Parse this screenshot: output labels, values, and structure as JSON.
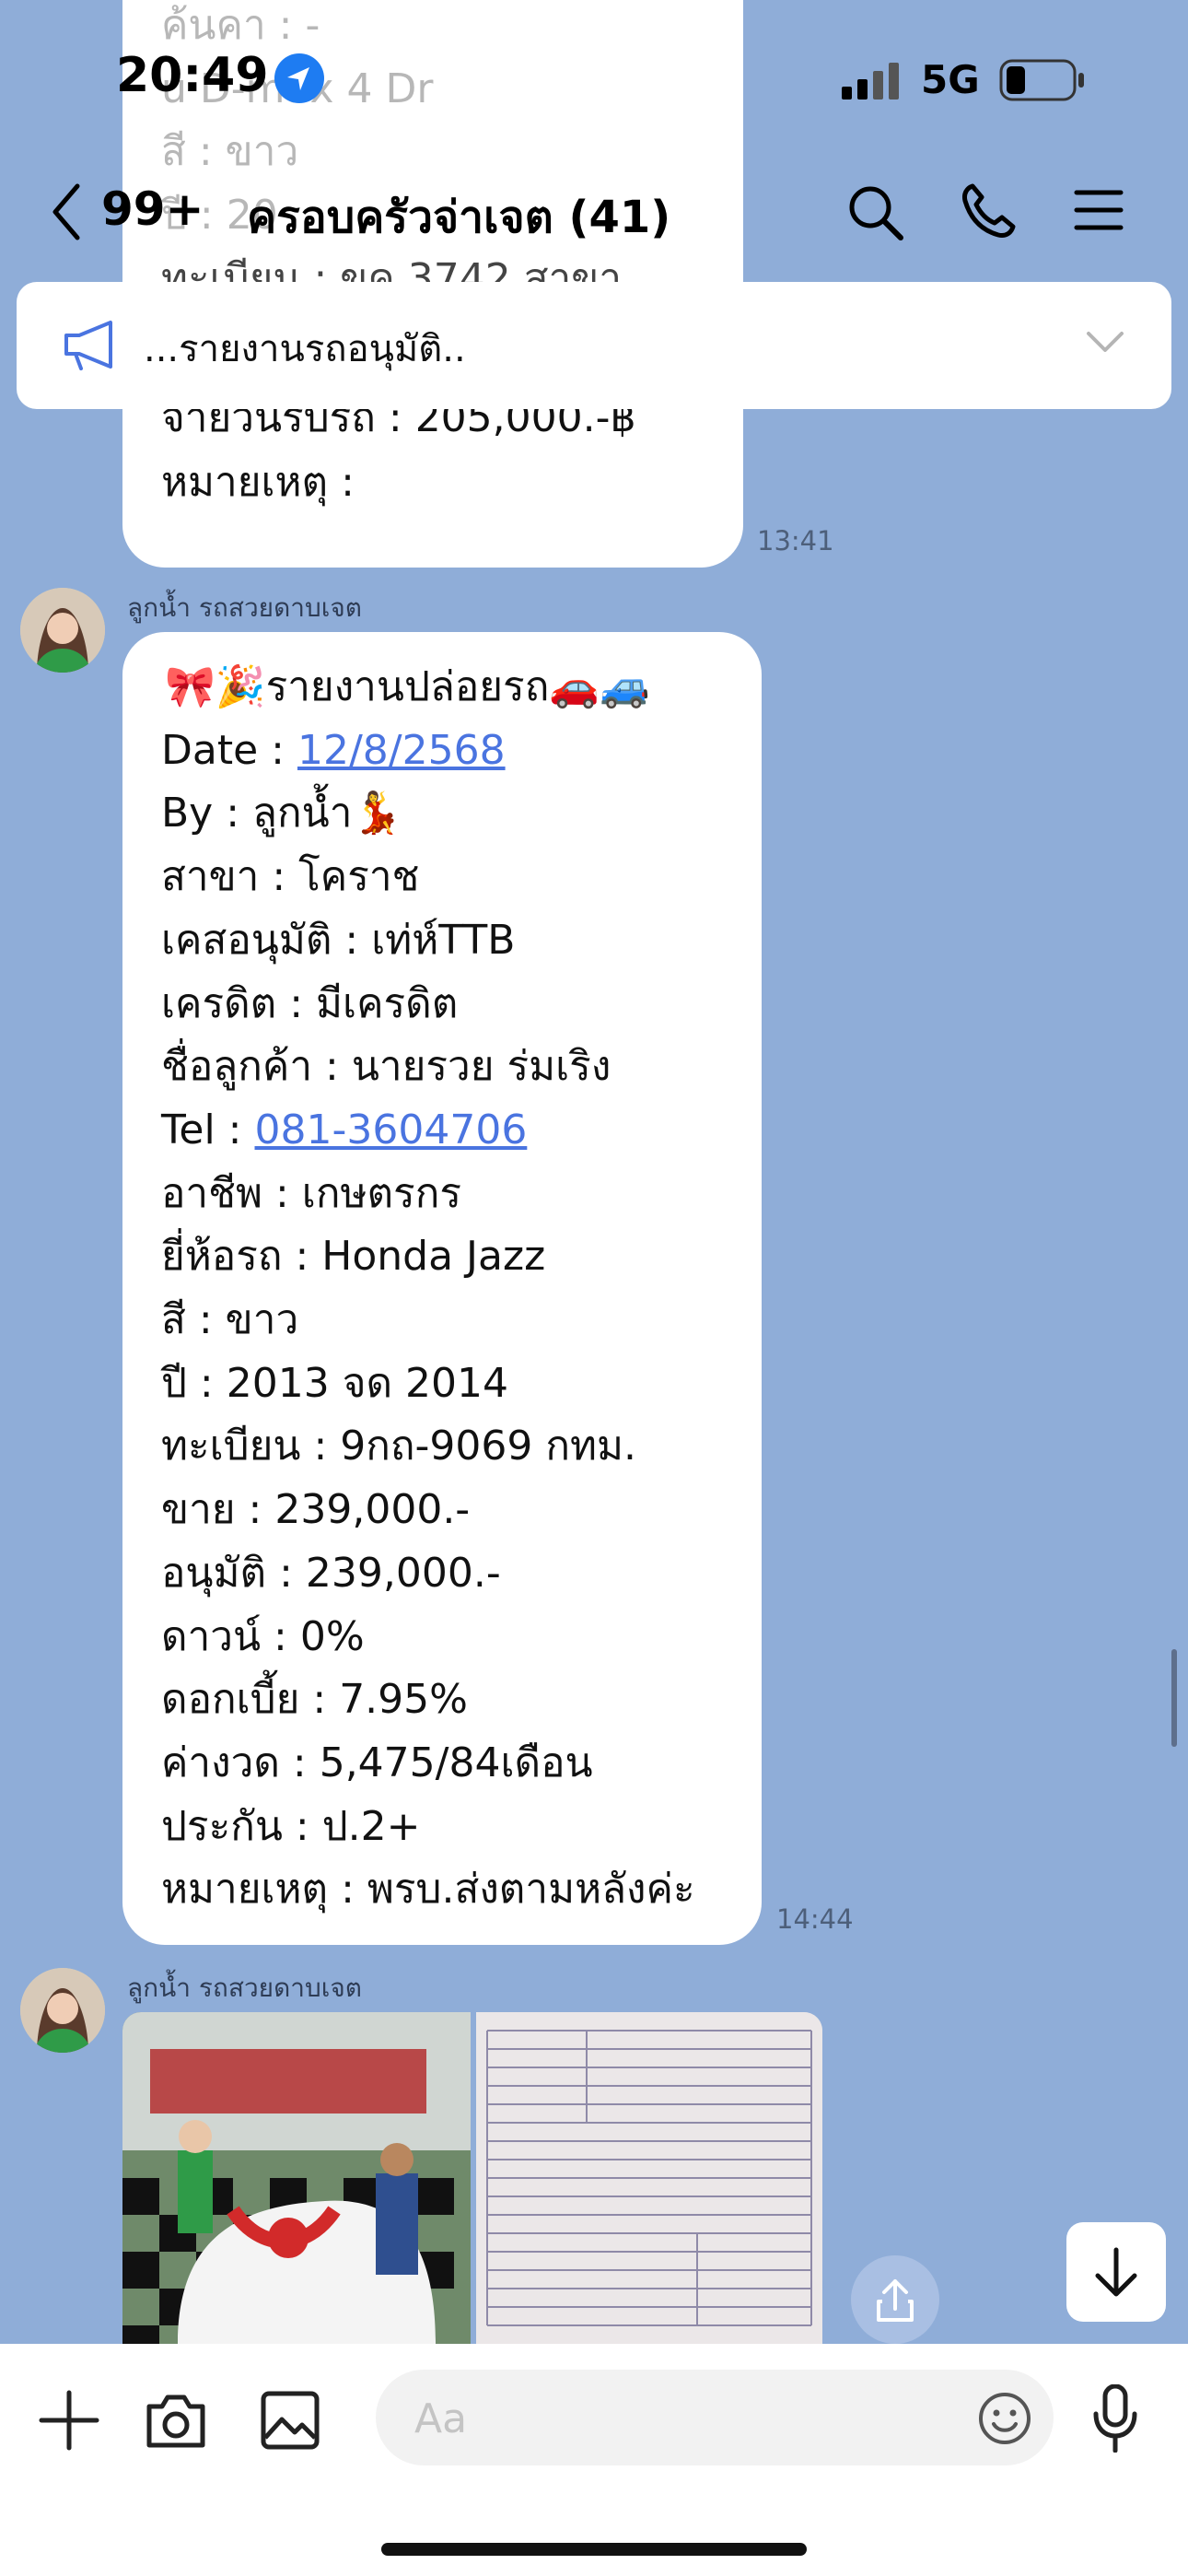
{
  "status_bar": {
    "time": "20:49",
    "network": "5G"
  },
  "header": {
    "back_count": "99+",
    "title": "ครอบครัวจ่าเจต (41)"
  },
  "announcement": {
    "text": "...รายงานรถอนุมัติ.."
  },
  "prev_message": {
    "faded_lines": [
      "ค้นคา : -",
      "u D-max 4 Dr",
      "สี : ขาว",
      "ปี : 20",
      "ทะเบียน : ขค 3742 สาขา"
    ],
    "lines": [
      "จ่ายวันรับรถ : 205,000.-฿",
      "หมายเหตุ :"
    ],
    "time": "13:41"
  },
  "message": {
    "sender": "ลูกน้ำ รถสวยดาบเจต",
    "lines": [
      {
        "label": "🎀🎉รายงานปล่อยรถ🚗🚙"
      },
      {
        "label": "Date : ",
        "link": "12/8/2568"
      },
      {
        "label": "By : ลูกน้ำ💃"
      },
      {
        "label": "สาขา : โคราช"
      },
      {
        "label": "เคสอนุมัติ : เท่ห์TTB"
      },
      {
        "label": "เครดิต : มีเครดิต"
      },
      {
        "label": "ชื่อลูกค้า : นายรวย ร่มเริง"
      },
      {
        "label": "Tel : ",
        "link": "081-3604706"
      },
      {
        "label": "อาชีพ : เกษตรกร"
      },
      {
        "label": "ยี่ห้อรถ : Honda Jazz"
      },
      {
        "label": "สี : ขาว"
      },
      {
        "label": "ปี : 2013 จด 2014"
      },
      {
        "label": "ทะเบียน : 9กถ-9069 กทม."
      },
      {
        "label": "ขาย : 239,000.-"
      },
      {
        "label": "อนุมัติ : 239,000.-"
      },
      {
        "label": "ดาวน์ : 0%"
      },
      {
        "label": "ดอกเบี้ย : 7.95%"
      },
      {
        "label": "ค่างวด : 5,475/84เดือน"
      },
      {
        "label": "ประกัน : ป.2+"
      },
      {
        "label": "หมายเหตุ : พรบ.ส่งตามหลังค่ะ"
      }
    ],
    "time": "14:44"
  },
  "photo_message": {
    "sender": "ลูกน้ำ รถสวยดาบเจต"
  },
  "input_bar": {
    "placeholder": "Aa"
  },
  "colors": {
    "background": "#8fadd8",
    "link": "#4a74e0",
    "bubble": "#ffffff"
  }
}
